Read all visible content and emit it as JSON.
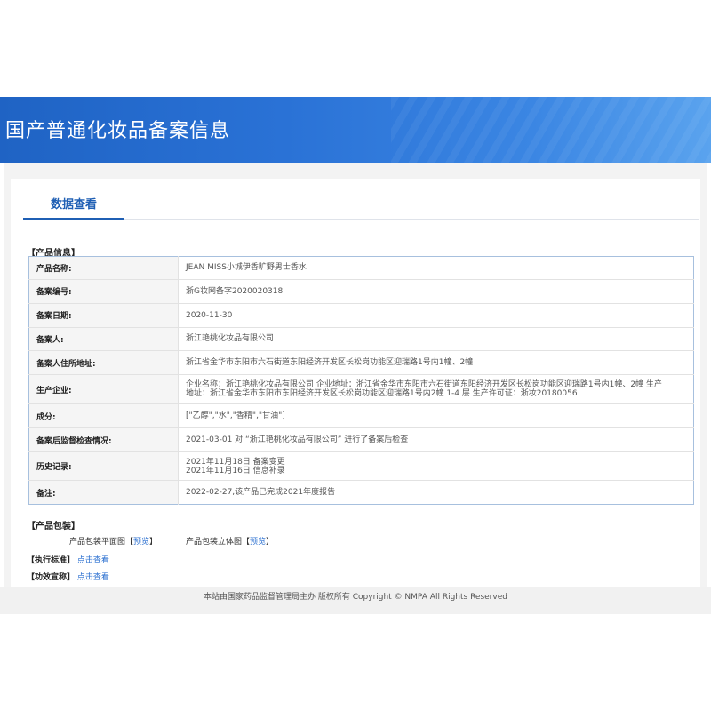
{
  "banner": {
    "title": "国产普通化妆品备案信息"
  },
  "tabs": [
    {
      "label": "数据查看"
    }
  ],
  "product_info": {
    "section_label": "【产品信息】",
    "rows": [
      {
        "key": "产品名称:",
        "value": "JEAN MISS小城伊香旷野男士香水"
      },
      {
        "key": "备案编号:",
        "value": "浙G妆网备字2020020318"
      },
      {
        "key": "备案日期:",
        "value": "2020-11-30"
      },
      {
        "key": "备案人:",
        "value": "浙江艳桃化妆品有限公司"
      },
      {
        "key": "备案人住所地址:",
        "value": "浙江省金华市东阳市六石街道东阳经济开发区长松岗功能区迎瑞路1号内1幢、2幢"
      },
      {
        "key": "生产企业:",
        "value": "企业名称：浙江艳桃化妆品有限公司 企业地址：浙江省金华市东阳市六石街道东阳经济开发区长松岗功能区迎瑞路1号内1幢、2幢 生产地址：浙江省金华市东阳市东阳经济开发区长松岗功能区迎瑞路1号内2幢 1-4 层 生产许可证：浙妆20180056"
      },
      {
        "key": "成分:",
        "value": "[\"乙醇\",\"水\",\"香精\",\"甘油\"]"
      },
      {
        "key": "备案后监督检查情况:",
        "value": "2021-03-01 对 “浙江艳桃化妆品有限公司” 进行了备案后检查"
      },
      {
        "key": "历史记录:",
        "lines": [
          "2021年11月18日 备案变更",
          "2021年11月16日 信息补录"
        ]
      },
      {
        "key": "备注:",
        "value": "2022-02-27,该产品已完成2021年度报告"
      }
    ]
  },
  "packaging": {
    "section_label": "【产品包装】",
    "flat_label": "产品包装平面图",
    "three_d_label": "产品包装立体图",
    "bracket_open": "【",
    "bracket_close": "】",
    "preview_label": "预览"
  },
  "standards": {
    "label": "【执行标准】",
    "link": "点击查看"
  },
  "efficacy": {
    "label": "【功效宣称】",
    "link": "点击查看"
  },
  "footer": {
    "text": "本站由国家药品监督管理局主办 版权所有 Copyright © NMPA All Rights Reserved"
  },
  "colors": {
    "banner_blue": "#2a72d6",
    "link_blue": "#2a6fd0",
    "tab_blue": "#1f5fb4"
  }
}
